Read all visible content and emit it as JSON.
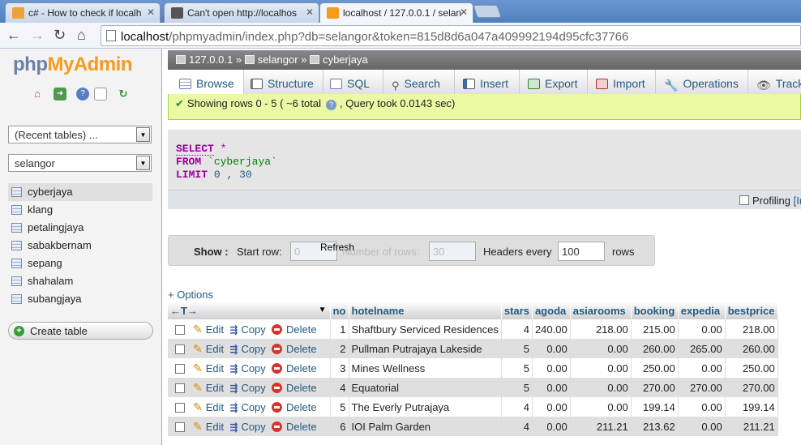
{
  "browser": {
    "tabs": [
      {
        "title": "c# - How to check if localh",
        "icon_color": "#e8a33a"
      },
      {
        "title": "Can't open http://localhos",
        "icon_color": "#555555"
      },
      {
        "title": "localhost / 127.0.0.1 / selan",
        "icon_color": "#f59b1d",
        "active": true
      }
    ],
    "url_host": "localhost",
    "url_rest": "/phpmyadmin/index.php?db=selangor&token=815d8d6a047a409992194d95cfc37766"
  },
  "sidebar": {
    "logo_part1": "php",
    "logo_part2": "MyAdmin",
    "recent_tables": "(Recent tables) ...",
    "database": "selangor",
    "tables": [
      "cyberjaya",
      "klang",
      "petalingjaya",
      "sabakbernam",
      "sepang",
      "shahalam",
      "subangjaya"
    ],
    "create_table": "Create table"
  },
  "breadcrumb": {
    "server": "127.0.0.1",
    "database": "selangor",
    "table": "cyberjaya",
    "separator": "»"
  },
  "menu": {
    "browse": "Browse",
    "structure": "Structure",
    "sql": "SQL",
    "search": "Search",
    "insert": "Insert",
    "export": "Export",
    "import": "Import",
    "operations": "Operations",
    "tracking": "Track"
  },
  "message": {
    "rows_text": "Showing rows 0 - 5 ( ~6 total",
    "query_text": ", Query took 0.0143 sec)"
  },
  "sql": {
    "select_kw": "SELECT",
    "star": "*",
    "from_kw": "FROM",
    "table": "`cyberjaya`",
    "limit_kw": "LIMIT",
    "offset": "0",
    "comma": ",",
    "count": "30"
  },
  "profiling": {
    "label": "Profiling",
    "edit_hint": "[In"
  },
  "navigation": {
    "show_label": "Show :",
    "start_row_label": "Start row:",
    "start_row_value": "0",
    "refresh_label": "Refresh",
    "num_rows_label": "Number of rows:",
    "num_rows_value": "30",
    "headers_every_label": "Headers every",
    "headers_every_value": "100",
    "rows_label": "rows"
  },
  "options_link": "+ Options",
  "table": {
    "arrows": "←T→",
    "columns": [
      "no",
      "hotelname",
      "stars",
      "agoda",
      "asiarooms",
      "booking",
      "expedia",
      "bestprice"
    ],
    "actions": {
      "edit": "Edit",
      "copy": "Copy",
      "delete": "Delete"
    },
    "rows": [
      [
        "1",
        "Shaftbury Serviced Residences",
        "4",
        "240.00",
        "218.00",
        "215.00",
        "0.00",
        "218.00"
      ],
      [
        "2",
        "Pullman Putrajaya Lakeside",
        "5",
        "0.00",
        "0.00",
        "260.00",
        "265.00",
        "260.00"
      ],
      [
        "3",
        "Mines Wellness",
        "5",
        "0.00",
        "0.00",
        "250.00",
        "0.00",
        "250.00"
      ],
      [
        "4",
        "Equatorial",
        "5",
        "0.00",
        "0.00",
        "270.00",
        "270.00",
        "270.00"
      ],
      [
        "5",
        "The Everly Putrajaya",
        "4",
        "0.00",
        "0.00",
        "199.14",
        "0.00",
        "199.14"
      ],
      [
        "6",
        "IOI Palm Garden",
        "4",
        "0.00",
        "211.21",
        "213.62",
        "0.00",
        "211.21"
      ]
    ]
  }
}
